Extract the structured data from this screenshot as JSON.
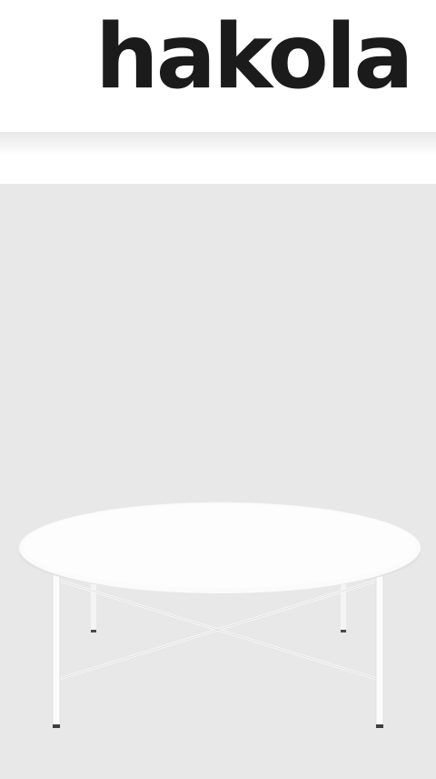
{
  "header": {
    "logo_text": "hakola"
  },
  "product": {
    "image_icon": "round-coffee-table-icon",
    "colors": {
      "background": "#e8e8e8",
      "table": "#fafafa"
    }
  }
}
